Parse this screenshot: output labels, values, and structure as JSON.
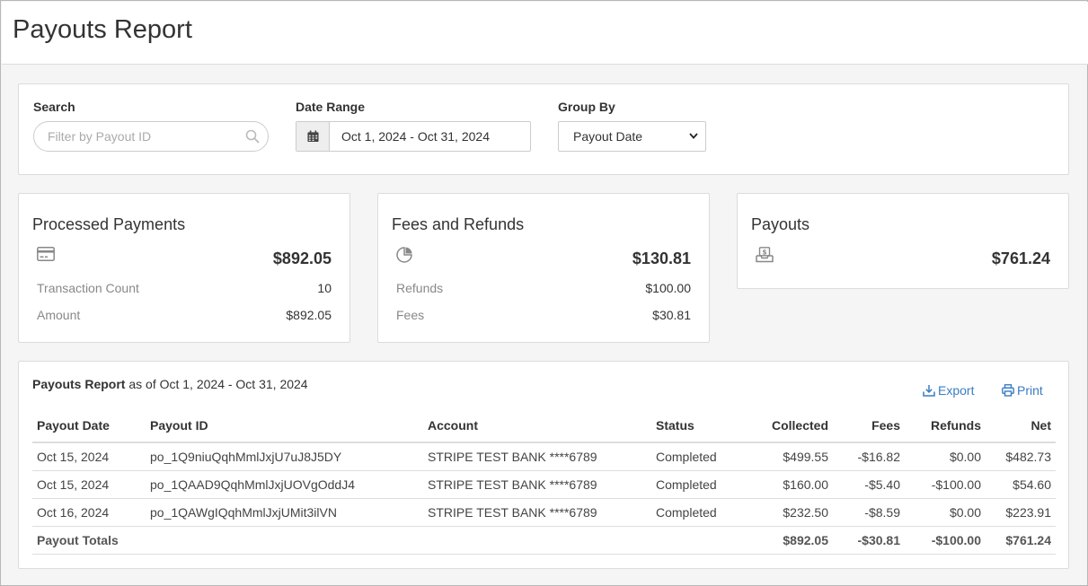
{
  "page": {
    "title": "Payouts Report"
  },
  "filters": {
    "search_label": "Search",
    "search_placeholder": "Filter by Payout ID",
    "search_value": "",
    "date_label": "Date Range",
    "date_value": "Oct 1, 2024 - Oct 31, 2024",
    "group_label": "Group By",
    "group_value": "Payout Date"
  },
  "processed": {
    "title": "Processed Payments",
    "icon": "credit-card-icon",
    "total": "$892.05",
    "rows": [
      {
        "label": "Transaction Count",
        "value": "10"
      },
      {
        "label": "Amount",
        "value": "$892.05"
      }
    ]
  },
  "fees": {
    "title": "Fees and Refunds",
    "icon": "pie-chart-icon",
    "total": "$130.81",
    "rows": [
      {
        "label": "Refunds",
        "value": "$100.00"
      },
      {
        "label": "Fees",
        "value": "$30.81"
      }
    ]
  },
  "payouts": {
    "title": "Payouts",
    "icon": "inbox-dollar-icon",
    "total": "$761.24"
  },
  "report": {
    "title_bold": "Payouts Report",
    "title_rest": " as of Oct 1, 2024 - Oct 31, 2024",
    "export_label": "Export",
    "print_label": "Print",
    "columns": [
      "Payout Date",
      "Payout ID",
      "Account",
      "Status",
      "Collected",
      "Fees",
      "Refunds",
      "Net"
    ],
    "rows": [
      [
        "Oct 15, 2024",
        "po_1Q9niuQqhMmlJxjU7uJ8J5DY",
        "STRIPE TEST BANK ****6789",
        "Completed",
        "$499.55",
        "-$16.82",
        "$0.00",
        "$482.73"
      ],
      [
        "Oct 15, 2024",
        "po_1QAAD9QqhMmlJxjUOVgOddJ4",
        "STRIPE TEST BANK ****6789",
        "Completed",
        "$160.00",
        "-$5.40",
        "-$100.00",
        "$54.60"
      ],
      [
        "Oct 16, 2024",
        "po_1QAWgIQqhMmlJxjUMit3ilVN",
        "STRIPE TEST BANK ****6789",
        "Completed",
        "$232.50",
        "-$8.59",
        "$0.00",
        "$223.91"
      ]
    ],
    "totals": [
      "Payout Totals",
      "",
      "",
      "",
      "$892.05",
      "-$30.81",
      "-$100.00",
      "$761.24"
    ]
  },
  "colors": {
    "link": "#3a7cc4",
    "muted_label": "#888888",
    "border": "#dcdcdc"
  }
}
